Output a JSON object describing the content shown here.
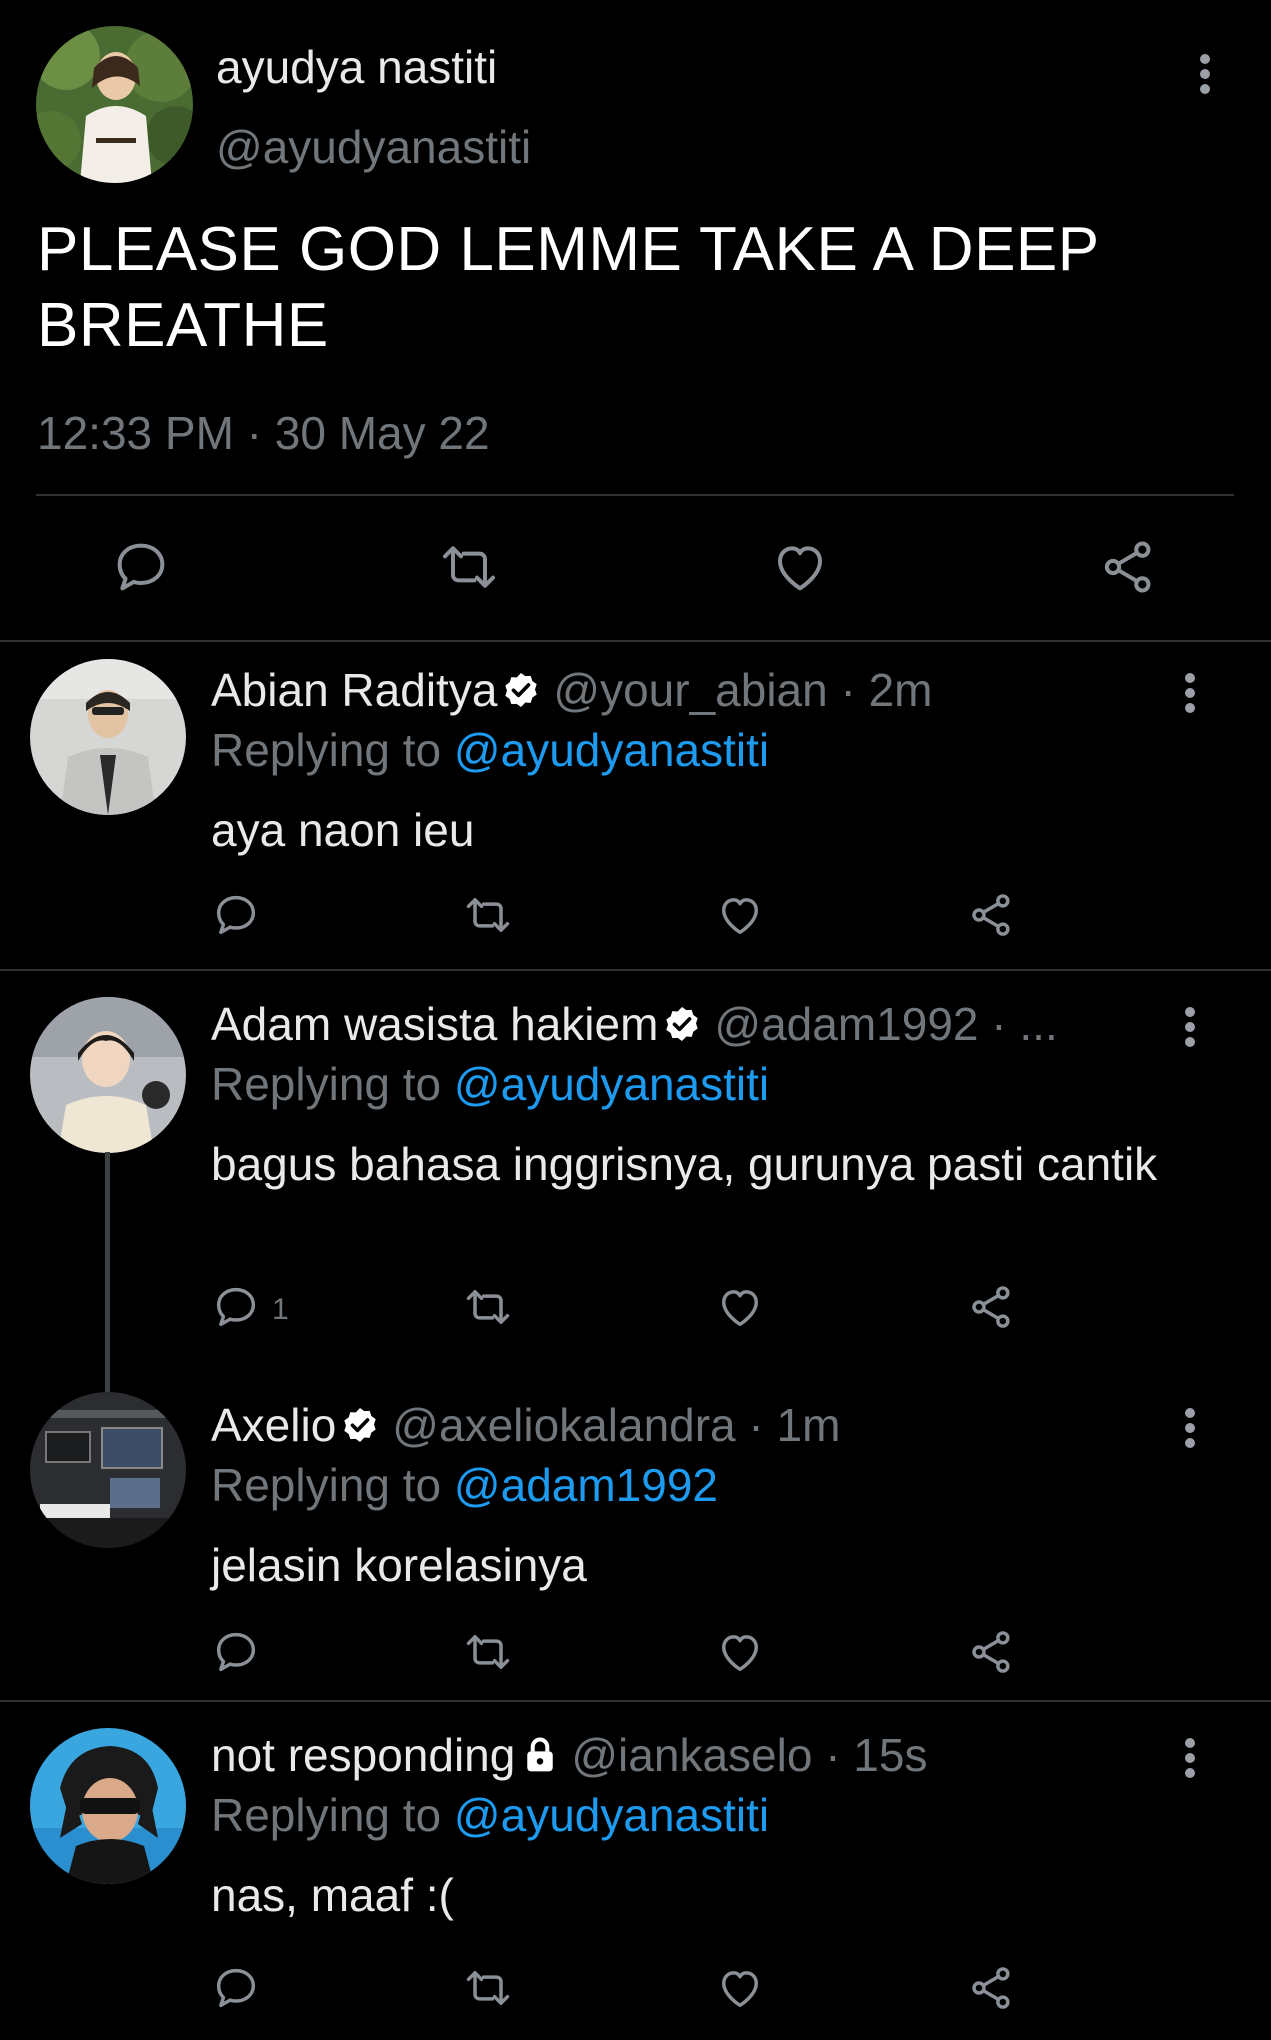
{
  "main_tweet": {
    "author_name": "ayudya nastiti",
    "author_handle": "@ayudyanastiti",
    "text": "PLEASE GOD LEMME TAKE A DEEP BREATHE",
    "timestamp": "12:33 PM · 30 May 22",
    "icons": [
      "reply-icon",
      "retweet-icon",
      "like-icon",
      "share-icon",
      "more-icon"
    ]
  },
  "replies": [
    {
      "name": "Abian Raditya",
      "verified": true,
      "handle_time": "@your_abian · 2m",
      "replying_prefix": "Replying to ",
      "replying_to": "@ayudyanastiti",
      "text": "aya naon ieu",
      "reply_count": ""
    },
    {
      "name": "Adam wasista hakiem",
      "verified": true,
      "handle_time": "@adam1992 · ...",
      "replying_prefix": "Replying to ",
      "replying_to": "@ayudyanastiti",
      "text": "bagus bahasa inggrisnya, gurunya pasti cantik",
      "reply_count": "1"
    },
    {
      "name": "Axelio",
      "verified": true,
      "handle_time": "@axeliokalandra · 1m",
      "replying_prefix": "Replying to ",
      "replying_to": "@adam1992",
      "text": "jelasin korelasinya",
      "reply_count": ""
    },
    {
      "name": "not responding",
      "verified": false,
      "protected": true,
      "handle_time": "@iankaselo · 15s",
      "replying_prefix": "Replying to ",
      "replying_to": "@ayudyanastiti",
      "text": "nas, maaf :(",
      "reply_count": ""
    }
  ],
  "colors": {
    "background": "#000000",
    "text": "#e7e9ea",
    "muted": "#71767b",
    "link": "#1d9bf0",
    "divider": "#2f3336"
  }
}
